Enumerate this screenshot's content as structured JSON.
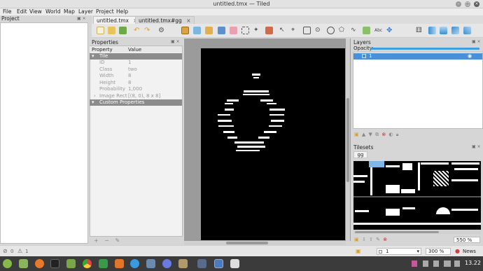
{
  "window": {
    "title": "untitled.tmx — Tiled"
  },
  "menu": [
    "File",
    "Edit",
    "View",
    "World",
    "Map",
    "Layer",
    "Project",
    "Help"
  ],
  "project_panel": {
    "title": "Project"
  },
  "tabs": [
    {
      "label": "untitled.tmx"
    },
    {
      "label": "untitled.tmx#gg"
    }
  ],
  "properties_panel": {
    "title": "Properties",
    "header": {
      "property": "Property",
      "value": "Value"
    },
    "group_tile": "Tile",
    "rows": [
      {
        "key": "ID",
        "value": "1"
      },
      {
        "key": "Class",
        "value": "two"
      },
      {
        "key": "Width",
        "value": "8"
      },
      {
        "key": "Height",
        "value": "8"
      },
      {
        "key": "Probability",
        "value": "1,000"
      },
      {
        "key": "Image Rect",
        "value": "[(8, 0), 8 x 8]"
      }
    ],
    "group_custom": "Custom Properties"
  },
  "layers_panel": {
    "title": "Layers",
    "opacity_label": "Opacity:",
    "layer_name": "1"
  },
  "tilesets_panel": {
    "title": "Tilesets",
    "tab": "gg"
  },
  "status": {
    "errors": "0",
    "warnings": "1",
    "layer_select": "1",
    "map_zoom": "300 %",
    "tileset_zoom": "550 %"
  },
  "taskbar": {
    "time": "13.22",
    "news": "News"
  },
  "colors": {
    "accent": "#3d9ee0",
    "selection": "#4a90d9",
    "map_bg": "#000000"
  }
}
